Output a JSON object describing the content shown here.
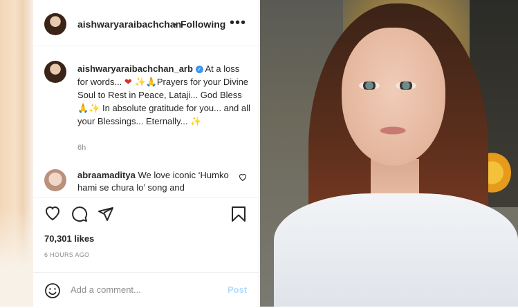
{
  "header": {
    "username": "aishwaryaraibachchan",
    "separator": "•",
    "follow_status": "Following",
    "more_label": "•••"
  },
  "caption": {
    "username": "aishwaryaraibachchan_arb",
    "verified_mark": "✓",
    "text_1": "At a loss for words... ",
    "heart": "❤",
    "sparkles_1": " ✨",
    "pray_1": "🙏",
    "text_2": "Prayers for your Divine Soul to Rest in Peace, Lataji... God Bless ",
    "pray_2": "🙏",
    "sparkles_2": "✨",
    "text_3": " In absolute gratitude for you... and all your Blessings... Eternally... ",
    "sparkles_3": "✨",
    "time": "6h"
  },
  "comment": {
    "username": "abraamaditya",
    "text": " We love iconic ‘Humko hami se chura lo’ song and"
  },
  "post": {
    "likes": "70,301 likes",
    "time_ago": "6 HOURS AGO"
  },
  "add_comment": {
    "placeholder": "Add a comment...",
    "post_label": "Post"
  },
  "colors": {
    "text": "#262626",
    "secondary": "#8e8e8e",
    "verified": "#3897f0",
    "post_disabled": "#b3dbff"
  },
  "icons": [
    "heart-icon",
    "comment-icon",
    "share-icon",
    "bookmark-icon",
    "emoji-icon",
    "more-icon"
  ]
}
